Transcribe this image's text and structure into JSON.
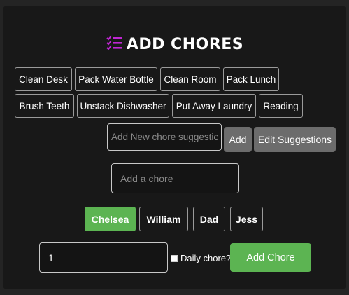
{
  "header": {
    "title": "ADD CHORES",
    "icon": "checklist-icon",
    "accent_color": "#c026d3"
  },
  "suggestions": [
    "Clean Desk",
    "Pack Water Bottle",
    "Clean Room",
    "Pack Lunch",
    "Brush Teeth",
    "Unstack Dishwasher",
    "Put Away Laundry",
    "Reading"
  ],
  "suggestion_form": {
    "placeholder": "Add New chore suggestion",
    "add_label": "Add",
    "edit_label": "Edit Suggestions"
  },
  "chore_input": {
    "placeholder": "Add a chore"
  },
  "people": [
    {
      "name": "Chelsea",
      "selected": true
    },
    {
      "name": "William",
      "selected": false
    },
    {
      "name": "Dad",
      "selected": false
    },
    {
      "name": "Jess",
      "selected": false
    }
  ],
  "footer": {
    "quantity_value": "1",
    "daily_label": "Daily chore?",
    "daily_checked": false,
    "add_chore_label": "Add Chore",
    "primary_color": "#5cb452"
  }
}
